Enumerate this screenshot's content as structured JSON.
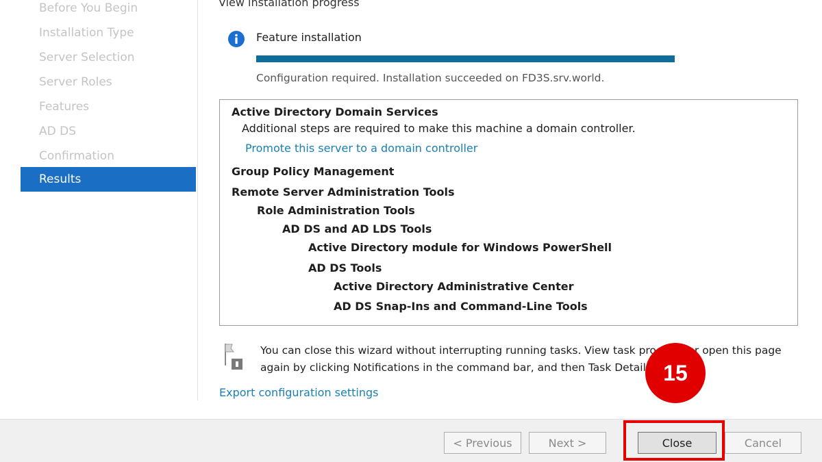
{
  "sidebar": {
    "items": [
      {
        "label": "Before You Begin",
        "active": false
      },
      {
        "label": "Installation Type",
        "active": false
      },
      {
        "label": "Server Selection",
        "active": false
      },
      {
        "label": "Server Roles",
        "active": false
      },
      {
        "label": "Features",
        "active": false
      },
      {
        "label": "AD DS",
        "active": false
      },
      {
        "label": "Confirmation",
        "active": false
      },
      {
        "label": "Results",
        "active": true
      }
    ]
  },
  "main": {
    "heading": "View installation progress",
    "info_icon": "info-icon",
    "feature_label": "Feature installation",
    "progress_fraction": 1.0,
    "status_text": "Configuration required. Installation succeeded on FD3S.srv.world.",
    "results": [
      {
        "text": "Active Directory Domain Services",
        "indent": 0,
        "style": "bold"
      },
      {
        "text": "Additional steps are required to make this machine a domain controller.",
        "indent": 1,
        "style": "normal"
      },
      {
        "text": "Promote this server to a domain controller",
        "indent": 1,
        "style": "link"
      },
      {
        "text": "Group Policy Management",
        "indent": 0,
        "style": "bold"
      },
      {
        "text": "Remote Server Administration Tools",
        "indent": 0,
        "style": "bold"
      },
      {
        "text": "Role Administration Tools",
        "indent": 1,
        "style": "bold"
      },
      {
        "text": "AD DS and AD LDS Tools",
        "indent": 2,
        "style": "bold"
      },
      {
        "text": "Active Directory module for Windows PowerShell",
        "indent": 3,
        "style": "bold"
      },
      {
        "text": "AD DS Tools",
        "indent": 3,
        "style": "bold"
      },
      {
        "text": "Active Directory Administrative Center",
        "indent": 4,
        "style": "bold"
      },
      {
        "text": "AD DS Snap-Ins and Command-Line Tools",
        "indent": 4,
        "style": "bold"
      }
    ],
    "note": "You can close this wizard without interrupting running tasks. View task progress or open this page again by clicking Notifications in the command bar, and then Task Details.",
    "export_link": "Export configuration settings"
  },
  "footer": {
    "previous_label": "< Previous",
    "next_label": "Next >",
    "close_label": "Close",
    "cancel_label": "Cancel"
  },
  "annotation": {
    "step_number": "15",
    "color": "#e60000"
  },
  "colors": {
    "accent": "#1a6fc4",
    "progress": "#0e6d9b",
    "link": "#1a7fb5"
  }
}
